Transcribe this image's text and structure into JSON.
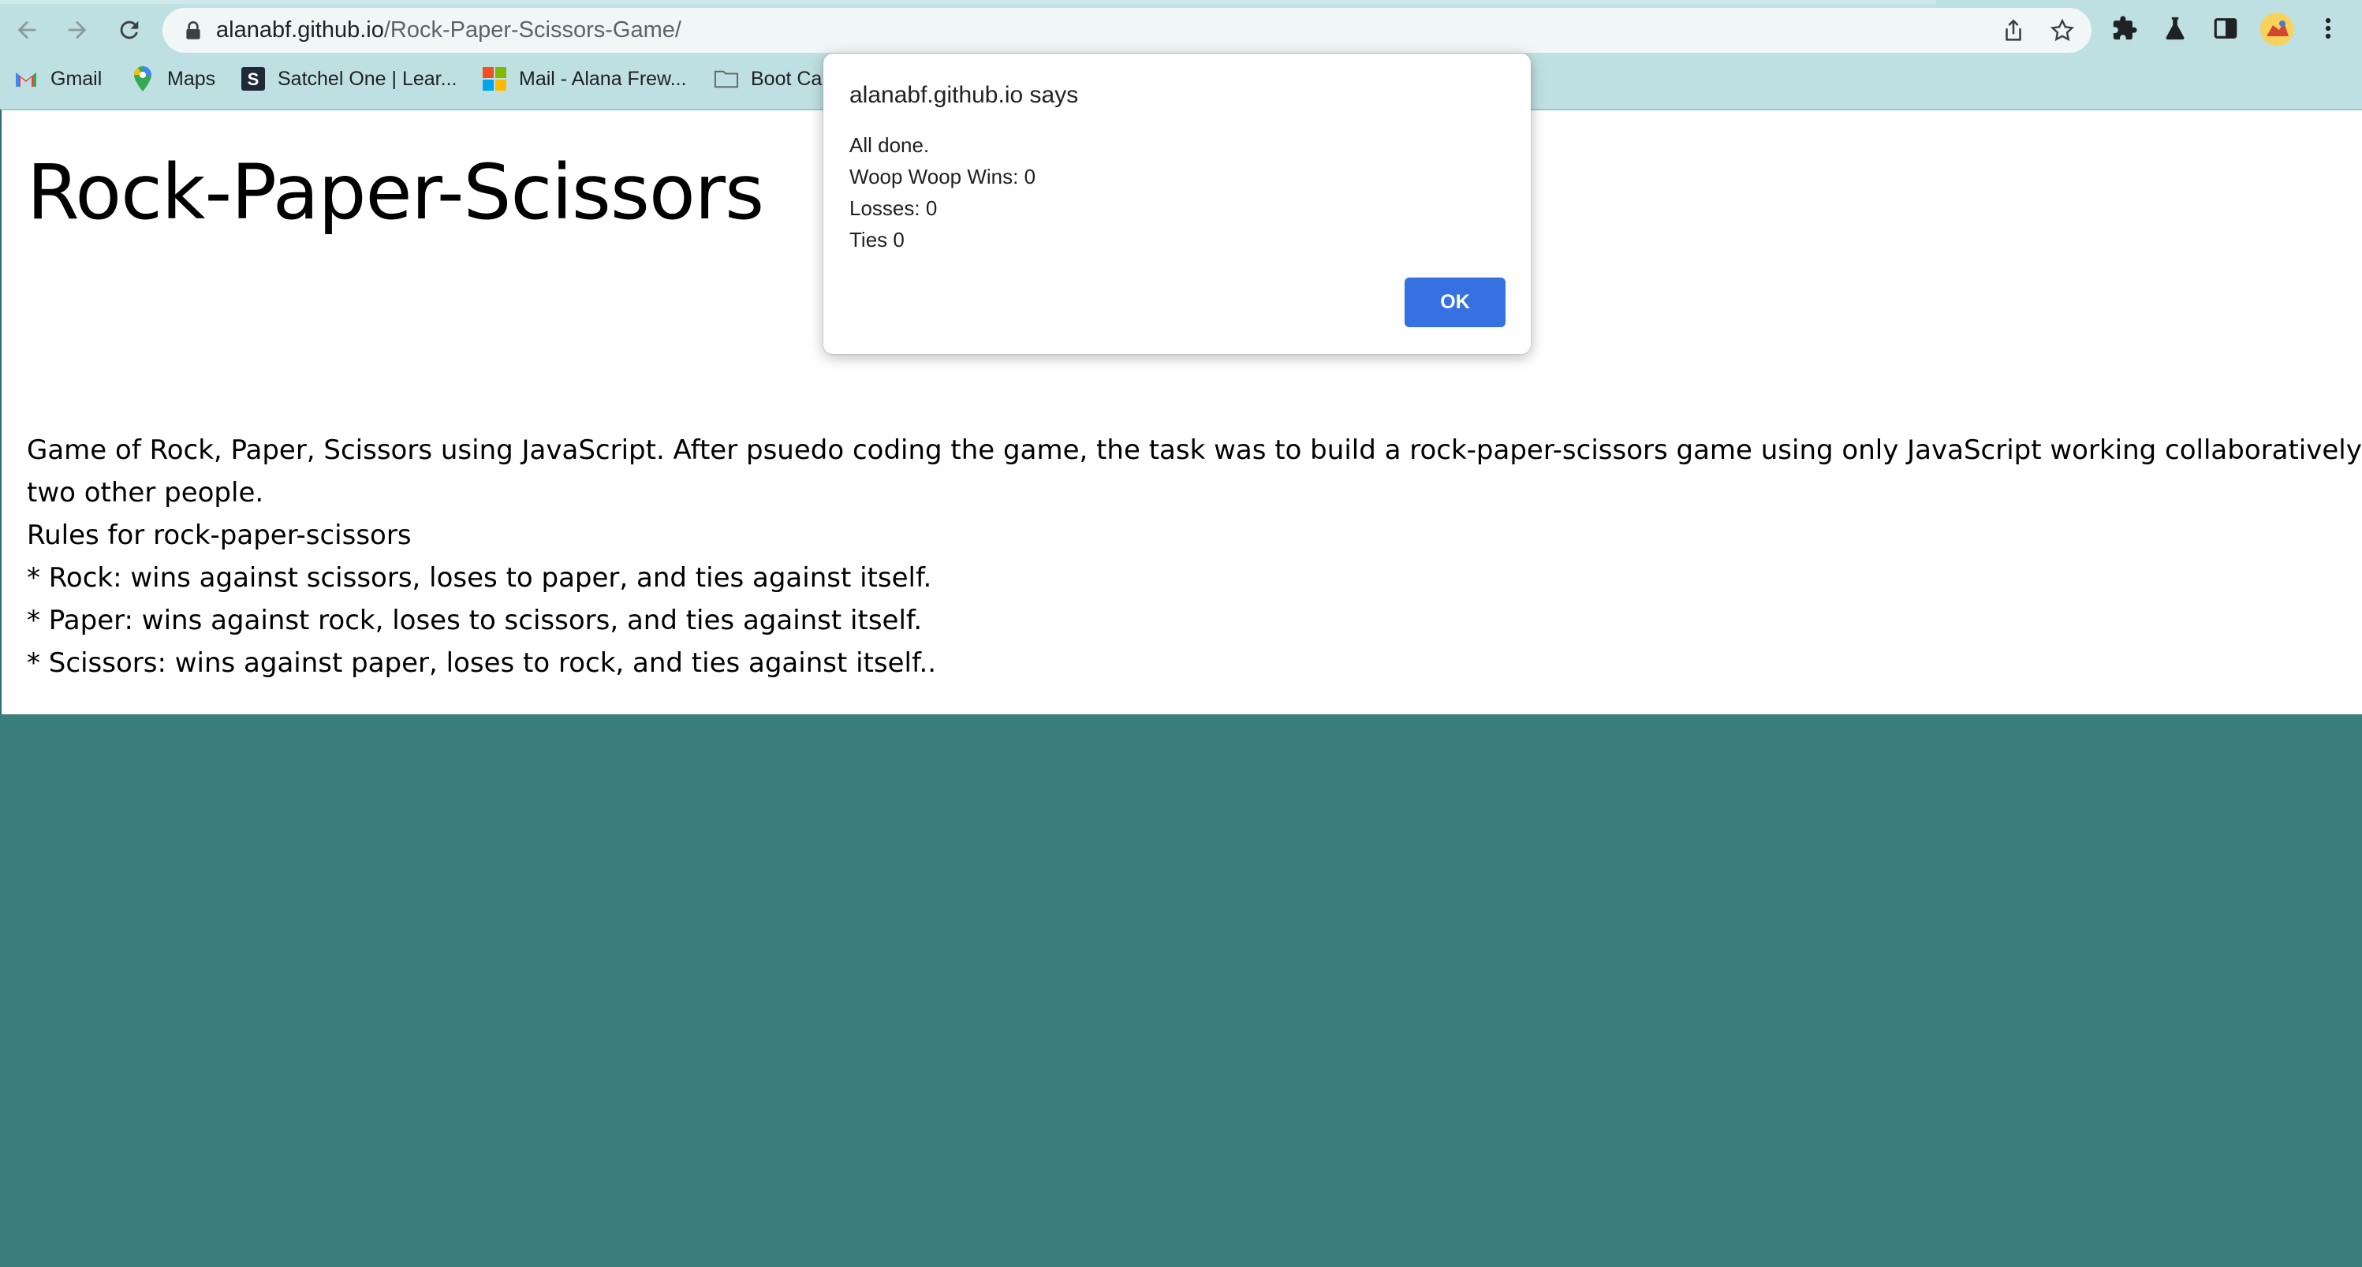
{
  "browser": {
    "url_host": "alanabf.github.io",
    "url_path": "/Rock-Paper-Scissors-Game/",
    "bookmarks": [
      {
        "label": "Gmail",
        "icon": "gmail-icon"
      },
      {
        "label": "Maps",
        "icon": "maps-icon"
      },
      {
        "label": "Satchel One | Lear...",
        "icon": "satchel-icon"
      },
      {
        "label": "Mail - Alana Frew...",
        "icon": "microsoft-icon"
      },
      {
        "label": "Boot Ca",
        "icon": "folder-icon"
      }
    ]
  },
  "page": {
    "title": "Rock-Paper-Scissors",
    "description_lines": [
      "Game of Rock, Paper, Scissors using JavaScript. After psuedo coding the game, the task was to build a rock-paper-scissors game using only JavaScript working collaboratively with",
      "two other people.",
      "Rules for rock-paper-scissors",
      "* Rock: wins against scissors, loses to paper, and ties against itself.",
      "* Paper: wins against rock, loses to scissors, and ties against itself.",
      "* Scissors: wins against paper, loses to rock, and ties against itself.."
    ]
  },
  "dialog": {
    "title": "alanabf.github.io says",
    "message_lines": [
      "All done.",
      "Woop Woop Wins: 0",
      "Losses: 0",
      "Ties 0"
    ],
    "ok_label": "OK"
  },
  "colors": {
    "page_background": "#3a7f7e",
    "chrome": "#bfe0e2",
    "ok_button": "#3571e0"
  }
}
